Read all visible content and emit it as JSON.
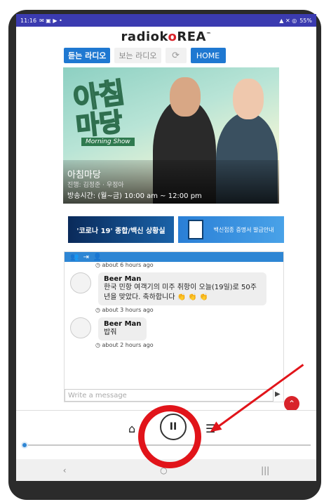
{
  "status": {
    "time": "11:16",
    "battery": "55%"
  },
  "brand": {
    "logo_text_left": "radiok",
    "logo_text_o": "o",
    "logo_text_right": "REA",
    "tm": "™"
  },
  "nav": {
    "listen_radio": "듣는 라디오",
    "watch_radio": "보는 라디오",
    "refresh_icon": "refresh-icon",
    "home": "HOME"
  },
  "hero": {
    "title_line1": "아침",
    "title_line2": "마당",
    "subtitle": "Morning Show",
    "program_name": "아침마당",
    "hosts": "진행: 김정준 · 우정아",
    "airtime": "방송시간: (월~금) 10:00 am ~ 12:00 pm"
  },
  "banners": {
    "covid": "'코로나 19' 종합/백신 상황실",
    "vaccine": "백신접종 증명서 발급안내"
  },
  "chat": {
    "messages": [
      {
        "time": "about 6 hours ago"
      },
      {
        "author": "Beer Man",
        "text": "한국 민항 여객기의 미주 취항이 오늘(19일)로 50주년을 맞았다. 축하합니다 👏 👏 👏",
        "time": "about 3 hours ago"
      },
      {
        "author": "Beer Man",
        "text": "밥줘",
        "time": "about 2 hours ago"
      }
    ],
    "input_placeholder": "Write a message"
  },
  "player": {
    "state": "playing",
    "progress_pct": 1
  },
  "colors": {
    "accent": "#1f78d1",
    "marker": "#e1141a",
    "brand_red": "#d8232a"
  }
}
